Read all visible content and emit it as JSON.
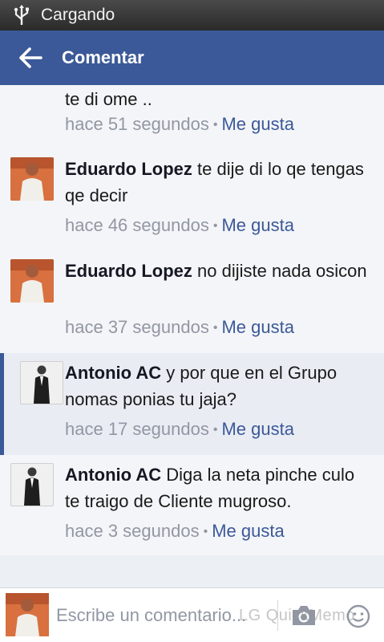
{
  "status_bar": {
    "text": "Cargando",
    "icon": "usb-icon"
  },
  "app_bar": {
    "title": "Comentar",
    "back_icon": "arrow-left-icon",
    "color": "#3b5998"
  },
  "comments": [
    {
      "author": "",
      "text": "te di ome ..",
      "time": "hace 51 segundos",
      "like": "Me gusta",
      "separator": "•"
    },
    {
      "author": "Eduardo Lopez",
      "text": " te dije di lo qe tengas qe decir",
      "time": "hace 46 segundos",
      "like": "Me gusta",
      "separator": "•"
    },
    {
      "author": "Eduardo Lopez",
      "text": " no dijiste nada osicon",
      "time": "hace 37 segundos",
      "like": "Me gusta",
      "separator": "•"
    },
    {
      "author": "Antonio AC",
      "text": " y por que en el Grupo nomas ponias tu jaja?",
      "time": "hace 17 segundos",
      "like": "Me gusta",
      "separator": "•"
    },
    {
      "author": "Antonio AC",
      "text": " Diga la neta pinche culo te traigo de Cliente mugroso.",
      "time": "hace 3 segundos",
      "like": "Me gusta",
      "separator": "•"
    }
  ],
  "composer": {
    "placeholder": "Escribe un comentario...",
    "camera_icon": "camera-icon",
    "send_icon": "smiley-icon"
  },
  "watermark": "LG QuickMemo"
}
